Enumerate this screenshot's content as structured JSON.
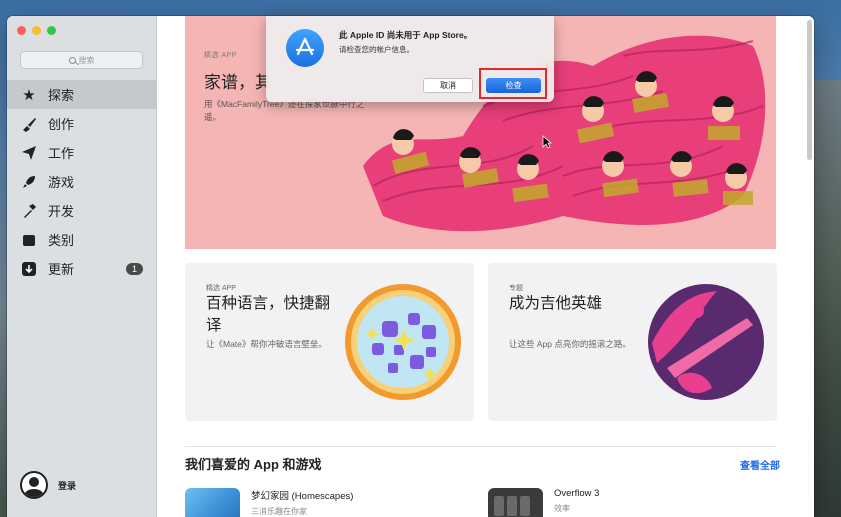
{
  "sidebar": {
    "search_placeholder": "搜索",
    "items": [
      {
        "label": "探索",
        "icon": "star-icon",
        "active": true
      },
      {
        "label": "创作",
        "icon": "brush-icon"
      },
      {
        "label": "工作",
        "icon": "paperplane-icon"
      },
      {
        "label": "游戏",
        "icon": "rocket-icon"
      },
      {
        "label": "开发",
        "icon": "hammer-icon"
      },
      {
        "label": "类别",
        "icon": "box-icon"
      },
      {
        "label": "更新",
        "icon": "download-icon",
        "badge": "1"
      }
    ],
    "login_label": "登录"
  },
  "hero": {
    "kicker": "精选 APP",
    "title": "家谱，其",
    "desc": "用《MacFamilyTree》迹在探家世脉中行之遥。"
  },
  "cards": [
    {
      "kicker": "精选 APP",
      "title": "百种语言，快捷翻译",
      "desc": "让《Mate》帮你冲破语言壁垒。"
    },
    {
      "kicker": "专题",
      "title": "成为吉他英雄",
      "desc": "让这些 App 点亮你的摇滚之路。"
    }
  ],
  "section": {
    "title": "我们喜爱的 App 和游戏",
    "see_all": "查看全部"
  },
  "apps": [
    {
      "name": "梦幻家园 (Homescapes)",
      "sub": "三消乐趣在你家"
    },
    {
      "name": "Overflow 3",
      "sub": "效率"
    }
  ],
  "dialog": {
    "title": "此 Apple ID 尚未用于 App Store。",
    "body": "请检查您的帐户信息。",
    "cancel": "取消",
    "confirm": "检查"
  },
  "colors": {
    "accent": "#1d6ee6",
    "highlight_box": "#e02929",
    "hero_bg": "#f5b5b5"
  }
}
